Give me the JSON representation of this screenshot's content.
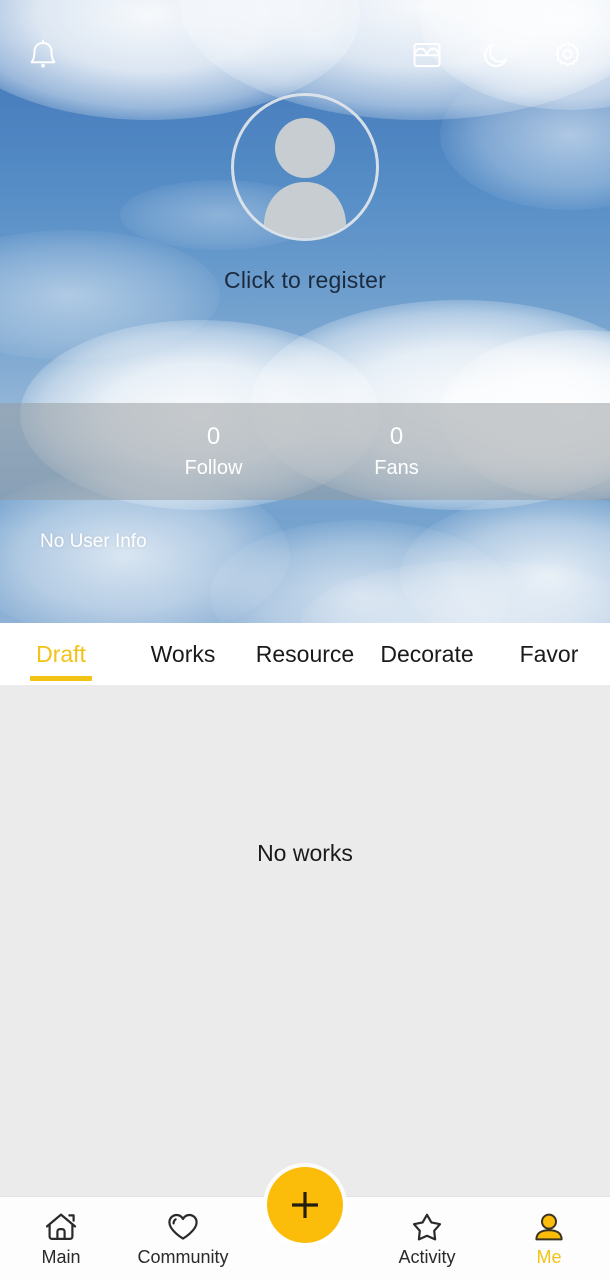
{
  "topbar": {
    "notification_icon": "bell-icon",
    "shop_icon": "shop-icon",
    "dark_mode_icon": "moon-icon",
    "settings_icon": "gear-icon"
  },
  "profile": {
    "avatar_icon": "default-avatar-icon",
    "register_label": "Click to register",
    "user_info": "No User Info",
    "stats": [
      {
        "value": "0",
        "label": "Follow"
      },
      {
        "value": "0",
        "label": "Fans"
      }
    ]
  },
  "tabs": {
    "active_index": 0,
    "items": [
      {
        "label": "Draft"
      },
      {
        "label": "Works"
      },
      {
        "label": "Resource"
      },
      {
        "label": "Decorate"
      },
      {
        "label": "Favor"
      }
    ]
  },
  "content": {
    "empty_message": "No works"
  },
  "bottom_nav": {
    "active_index": 4,
    "items": [
      {
        "label": "Main",
        "icon": "home-icon"
      },
      {
        "label": "Community",
        "icon": "heart-icon"
      },
      {
        "label": "Activity",
        "icon": "star-icon"
      },
      {
        "label": "Me",
        "icon": "person-icon"
      }
    ],
    "fab": {
      "icon": "plus-icon"
    }
  },
  "colors": {
    "accent": "#f2c215",
    "fab": "#fbbc0a",
    "content_bg": "#ebebeb",
    "tab_bg": "#ffffff",
    "text": "#1a1a1a"
  }
}
